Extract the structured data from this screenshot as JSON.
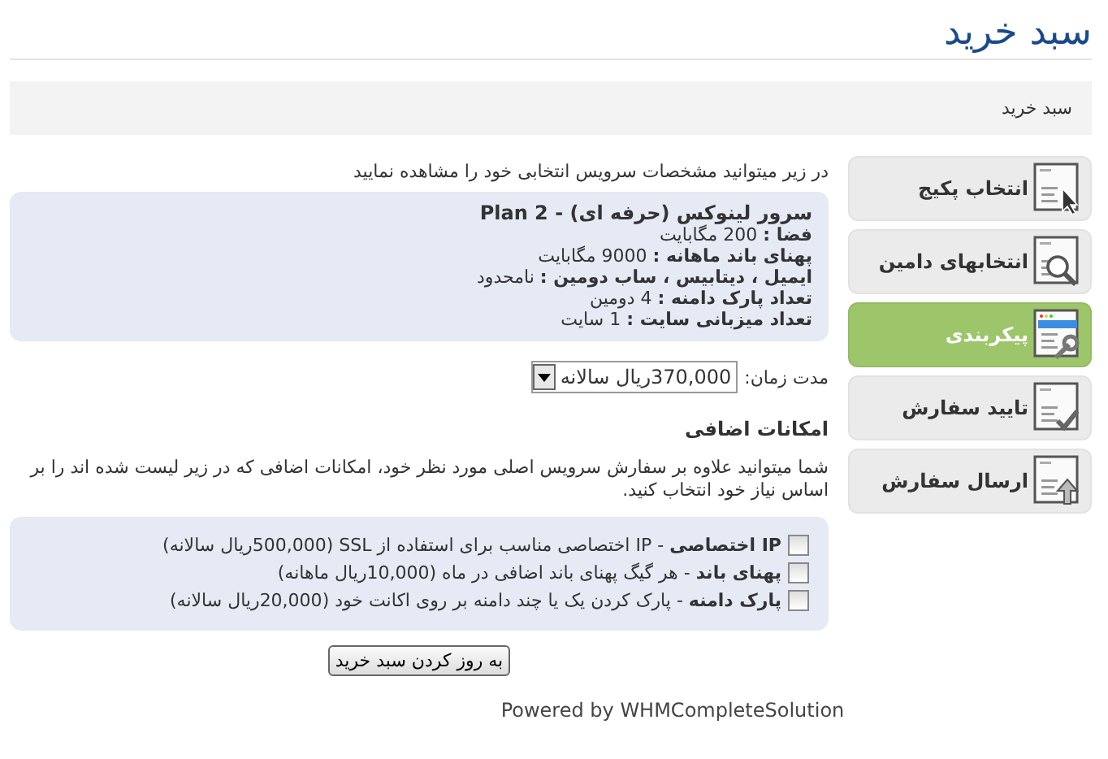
{
  "page_title": "سبد خرید",
  "breadcrumb": "سبد خرید",
  "steps": [
    {
      "label": "انتخاب پکیج",
      "selected": false
    },
    {
      "label": "انتخابهای دامین",
      "selected": false
    },
    {
      "label": "پیکربندی",
      "selected": true
    },
    {
      "label": "تایید سفارش",
      "selected": false
    },
    {
      "label": "ارسال سفارش",
      "selected": false
    }
  ],
  "intro": "در زیر میتوانید مشخصات سرویس انتخابی خود را مشاهده نمایید",
  "product": {
    "name": "سرور لینوکس (حرفه ای) - Plan 2",
    "specs": [
      "**فضا :** 200 مگابایت",
      "**پهنای باند ماهانه :** 9000 مگابایت",
      "**ایمیل ، دیتابیس ، ساب دومین :** نامحدود",
      "**تعداد پارک دامنه :** 4 دومین",
      "**تعداد میزبانی سایت :** 1 سایت"
    ]
  },
  "billing": {
    "label": "مدت زمان:",
    "value": "370,000ریال سالانه"
  },
  "addons_heading": "امکانات اضافی",
  "addons_intro": "شما میتوانید علاوه بر سفارش سرویس اصلی مورد نظر خود، امکانات اضافی که در زیر لیست شده اند را بر اساس نیاز خود انتخاب کنید.",
  "addons": [
    {
      "text": "**IP اختصاصی** - IP اختصاصی مناسب برای استفاده از SSL (500,000ریال سالانه)",
      "checked": false
    },
    {
      "text": "**پهنای باند** - هر گیگ پهنای باند اضافی در ماه (10,000ریال ماهانه)",
      "checked": false
    },
    {
      "text": "**پارک دامنه** - پارک کردن یک یا چند دامنه بر روی اکانت خود (20,000ریال سالانه)",
      "checked": false
    }
  ],
  "update_button": "به روز کردن سبد خرید",
  "footer": "Powered by WHMCompleteSolution"
}
